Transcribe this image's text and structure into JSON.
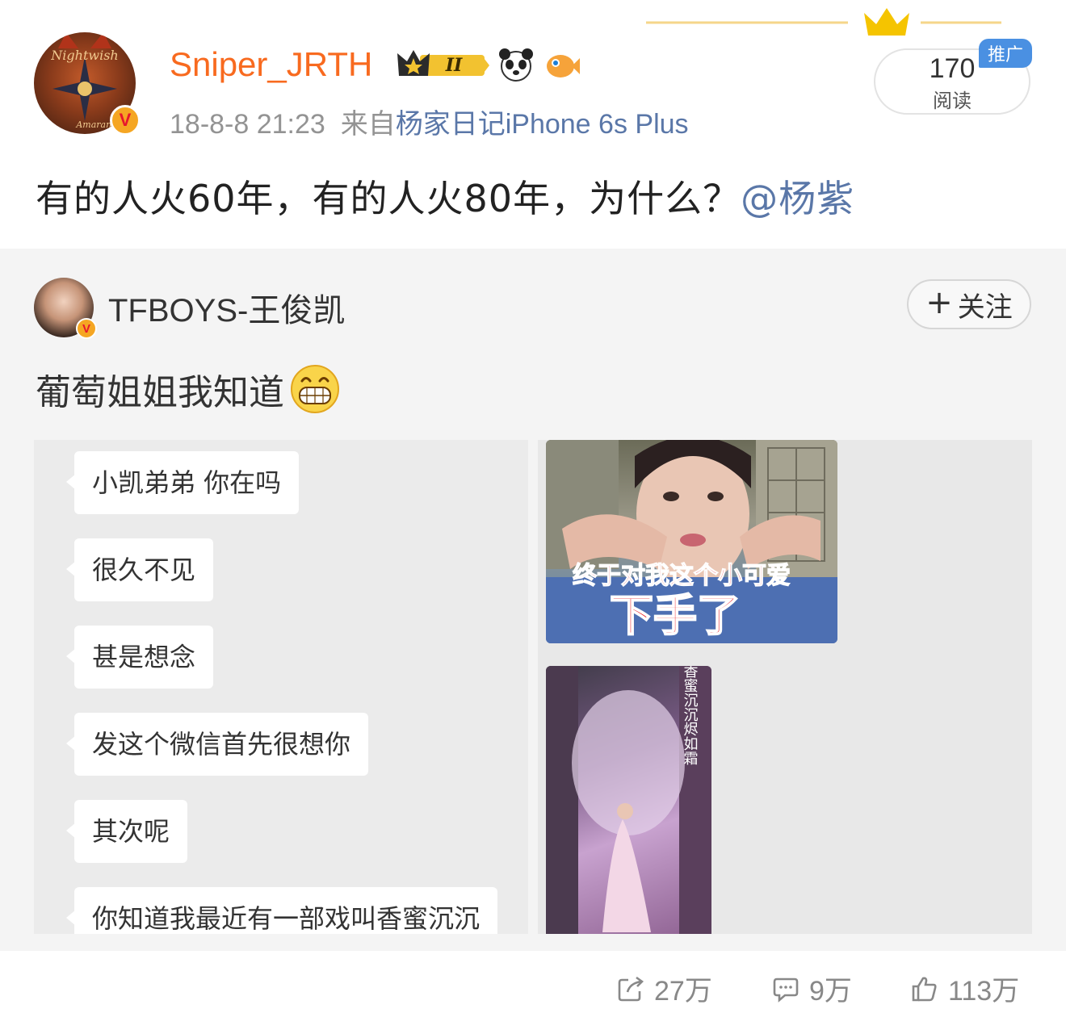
{
  "post": {
    "username": "Sniper_JRTH",
    "level_badge": "II",
    "timestamp": "18-8-8 21:23",
    "source_prefix": "来自",
    "source": "杨家日记iPhone 6s Plus",
    "text": "有的人火60年，有的人火80年，为什么？",
    "mention": "@杨紫",
    "reads_count": "170",
    "reads_label": "阅读",
    "promo_tag": "推广",
    "avatar_text_top": "Nightwish",
    "avatar_text_bottom": "Amaranth",
    "verified_badge": "V"
  },
  "repost": {
    "username": "TFBOYS-王俊凯",
    "verified_badge": "V",
    "follow_plus": "+",
    "follow_label": "关注",
    "text": "葡萄姐姐我知道",
    "emoji": "grin-emoji",
    "chat_messages": [
      "小凯弟弟 你在吗",
      "很久不见",
      "甚是想念",
      "发这个微信首先很想你",
      "其次呢",
      "你知道我最近有一部戏叫香蜜沉沉"
    ],
    "photo1_caption_line1": "终于对我这个小可爱",
    "photo1_caption_line2": "下手了",
    "photo2_title": "香蜜沉沉烬如霜"
  },
  "actions": {
    "share_count": "27万",
    "comment_count": "9万",
    "like_count": "113万"
  },
  "colors": {
    "username": "#f86a1f",
    "link": "#5a77a8",
    "meta": "#939393",
    "promo": "#4a90e2",
    "card_bg": "#f4f4f4"
  }
}
